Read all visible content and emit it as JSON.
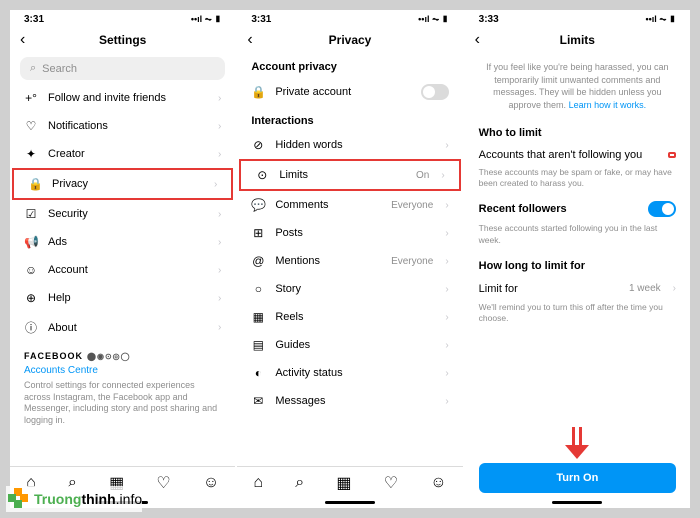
{
  "status": {
    "time1": "3:31",
    "time2": "3:31",
    "time3": "3:33"
  },
  "screen1": {
    "title": "Settings",
    "search_placeholder": "Search",
    "items": [
      {
        "icon": "user-plus-icon",
        "glyph": "+👤",
        "label": "Follow and invite friends"
      },
      {
        "icon": "bell-icon",
        "glyph": "🔔",
        "label": "Notifications"
      },
      {
        "icon": "creator-icon",
        "glyph": "✦",
        "label": "Creator"
      },
      {
        "icon": "lock-icon",
        "glyph": "🔒",
        "label": "Privacy",
        "highlight": true
      },
      {
        "icon": "shield-icon",
        "glyph": "🛡",
        "label": "Security"
      },
      {
        "icon": "megaphone-icon",
        "glyph": "📢",
        "label": "Ads"
      },
      {
        "icon": "account-icon",
        "glyph": "👤",
        "label": "Account"
      },
      {
        "icon": "help-icon",
        "glyph": "⊕",
        "label": "Help"
      },
      {
        "icon": "info-icon",
        "glyph": "ⓘ",
        "label": "About"
      }
    ],
    "facebook_label": "FACEBOOK",
    "accounts_centre": "Accounts Centre",
    "footer": "Control settings for connected experiences across Instagram, the Facebook app and Messenger, including story and post sharing and logging in."
  },
  "screen2": {
    "title": "Privacy",
    "section1": "Account privacy",
    "private_account": "Private account",
    "section2": "Interactions",
    "items": [
      {
        "icon": "eye-off-icon",
        "glyph": "⊘",
        "label": "Hidden words"
      },
      {
        "icon": "limits-icon",
        "glyph": "⊙",
        "label": "Limits",
        "value": "On",
        "highlight": true
      },
      {
        "icon": "comment-icon",
        "glyph": "💬",
        "label": "Comments",
        "value": "Everyone"
      },
      {
        "icon": "posts-icon",
        "glyph": "⊞",
        "label": "Posts"
      },
      {
        "icon": "mention-icon",
        "glyph": "@",
        "label": "Mentions",
        "value": "Everyone"
      },
      {
        "icon": "story-icon",
        "glyph": "○",
        "label": "Story"
      },
      {
        "icon": "reels-icon",
        "glyph": "▦",
        "label": "Reels"
      },
      {
        "icon": "guides-icon",
        "glyph": "▤",
        "label": "Guides"
      },
      {
        "icon": "activity-icon",
        "glyph": "◐",
        "label": "Activity status"
      },
      {
        "icon": "messages-icon",
        "glyph": "✉",
        "label": "Messages"
      }
    ]
  },
  "screen3": {
    "title": "Limits",
    "info": "If you feel like you're being harassed, you can temporarily limit unwanted comments and messages. They will be hidden unless you approve them.",
    "learn": "Learn how it works.",
    "who_to_limit": "Who to limit",
    "opt1_label": "Accounts that aren't following you",
    "opt1_sub": "These accounts may be spam or fake, or may have been created to harass you.",
    "opt2_label": "Recent followers",
    "opt2_sub": "These accounts started following you in the last week.",
    "how_long": "How long to limit for",
    "limit_for": "Limit for",
    "limit_val": "1 week",
    "remind": "We'll remind you to turn this off after the time you choose.",
    "turn_on": "Turn On"
  },
  "watermark": {
    "green": "Truong",
    "black": "thinh",
    "info": ".info"
  }
}
